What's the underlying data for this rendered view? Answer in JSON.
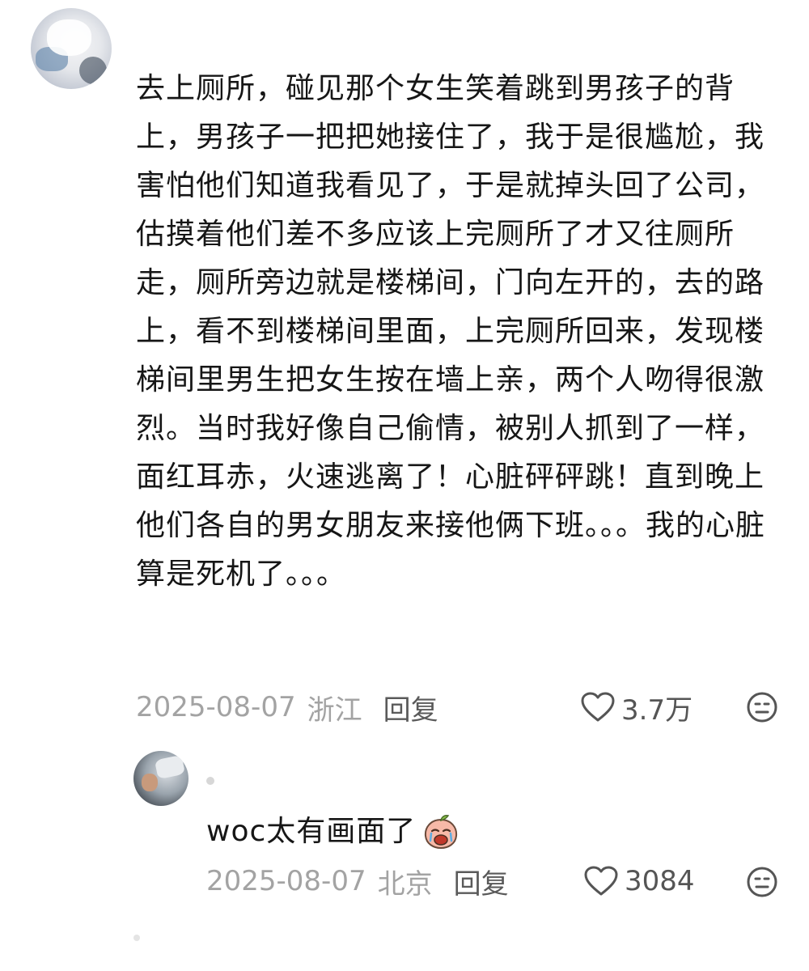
{
  "comment": {
    "text": "去上厕所，碰见那个女生笑着跳到男孩子的背上，男孩子一把把她接住了，我于是很尴尬，我害怕他们知道我看见了，于是就掉头回了公司，估摸着他们差不多应该上完厕所了才又往厕所走，厕所旁边就是楼梯间，门向左开的，去的路上，看不到楼梯间里面，上完厕所回来，发现楼梯间里男生把女生按在墙上亲，两个人吻得很激烈。当时我好像自己偷情，被别人抓到了一样，面红耳赤，火速逃离了！心脏砰砰跳！直到晚上他们各自的男女朋友来接他俩下班。。。我的心脏算是死机了。。。",
    "date": "2025-08-07",
    "location": "浙江",
    "reply_label": "回复",
    "likes": "3.7万"
  },
  "reply": {
    "text": "woc太有画面了",
    "date": "2025-08-07",
    "location": "北京",
    "reply_label": "回复",
    "likes": "3084"
  }
}
